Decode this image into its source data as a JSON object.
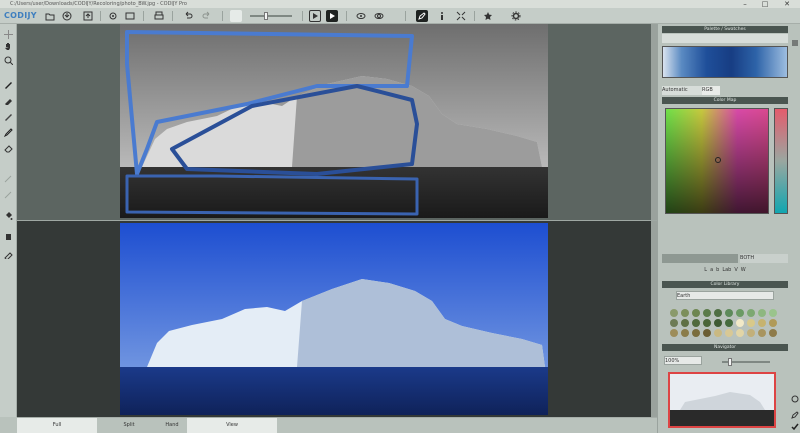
{
  "window": {
    "title": "C:/Users/user/Downloads/CODIJY/Recoloring/photo_BW.jpg - CODIJY Pro",
    "minimize": "–",
    "maximize": "□",
    "close": "✕"
  },
  "app": {
    "logo": "CODIJY"
  },
  "toolbar": {
    "zoom_value": "",
    "items": [
      "open-icon",
      "save-icon",
      "export-icon",
      "print-icon",
      "undo-icon",
      "redo-icon",
      "brush-size-slider",
      "play-outline-icon",
      "play-icon",
      "eye-icon",
      "eye-alt-icon",
      "pencil-icon",
      "info-icon",
      "fit-icon",
      "star-icon",
      "gear-icon"
    ]
  },
  "left_tools": [
    "move-icon",
    "hand-icon",
    "zoom-icon",
    "brush-icon",
    "dropper-icon",
    "pen-icon",
    "pencil-icon",
    "eraser-icon",
    "fill-icon",
    "pipette-icon"
  ],
  "panels": {
    "palette_header": "Palette / Swatches",
    "tab_a": "Automatic",
    "tab_b": "RGB",
    "colormap_header": "Color Map",
    "segmented": [
      "",
      "BOTH"
    ],
    "channels": [
      "L",
      "a",
      "b",
      "Lab",
      "V",
      "W"
    ],
    "library_header": "Color Library",
    "library_select": "Earth",
    "navigator_header": "Navigator",
    "zoom_label": "100%"
  },
  "swatches": [
    [
      "#8a9a6a",
      "#7c8f5b",
      "#6d8650",
      "#5b7b49",
      "#4f6f43",
      "#5d8a5a",
      "#6b9a64",
      "#7da872",
      "#8eb780",
      "#9ac48c"
    ],
    [
      "#6d7b55",
      "#5f7044",
      "#506a3b",
      "#4a6538",
      "#3e5a33",
      "#456b3d",
      "#f2eac8",
      "#d8c98a",
      "#c6b36f",
      "#b09a58"
    ],
    [
      "#9d8d5a",
      "#8b7d4a",
      "#7a6d3d",
      "#6b5e34",
      "#c9b982",
      "#d8c895",
      "#e2d5a6",
      "#c2b07a",
      "#a8955f",
      "#8e7b49"
    ]
  ],
  "bottom_tabs": [
    "Full",
    "Split",
    "Hand",
    "View",
    ""
  ],
  "colors": {
    "accent_blue": "#3f7fbf",
    "panel_bg": "#b9c2bc",
    "dark_bg": "#343937"
  }
}
